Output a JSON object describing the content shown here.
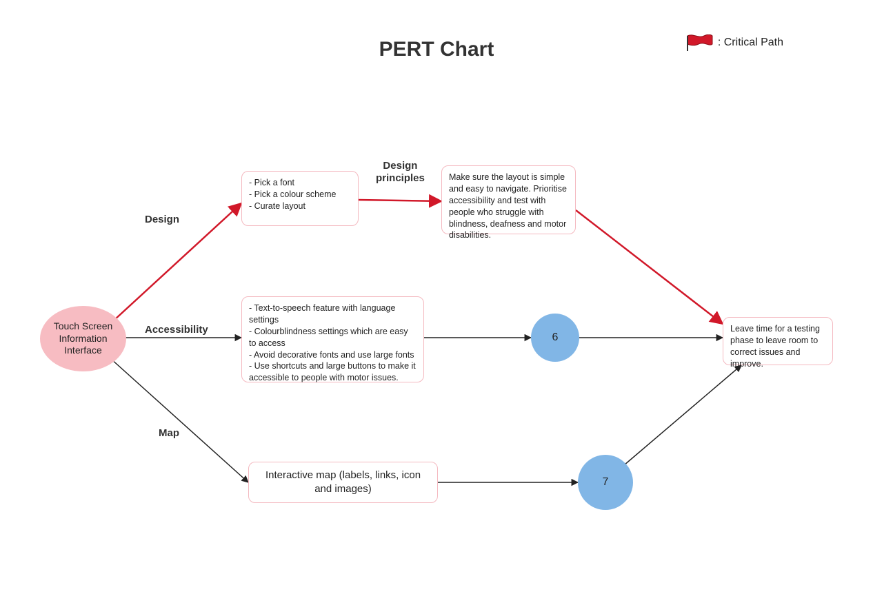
{
  "title": "PERT Chart",
  "legend_label": ": Critical Path",
  "nodes": {
    "start": "Touch Screen Information Interface",
    "design_box": "- Pick a font\n- Pick a colour scheme\n- Curate layout",
    "principles_box": "Make sure the layout is simple and easy to navigate. Prioritise accessibility and test with people who struggle with blindness, deafness and motor disabilities.",
    "accessibility_box": "- Text-to-speech feature with language settings\n- Colourblindness settings which are easy to access\n- Avoid decorative fonts and use large fonts\n- Use shortcuts and large buttons to make it accessible to people with motor issues.",
    "map_box": "Interactive map (labels, links, icon and images)",
    "node6": "6",
    "node7": "7",
    "end_box": "Leave time for a testing phase to leave room to correct issues and improve."
  },
  "edge_labels": {
    "design": "Design",
    "accessibility": "Accessibility",
    "map": "Map",
    "design_principles": "Design\nprinciples"
  },
  "colors": {
    "critical": "#d11829",
    "normal": "#222222",
    "pink_node": "#f7bcc2",
    "blue_node": "#81b6e6",
    "box_border": "#f4b9c0"
  }
}
